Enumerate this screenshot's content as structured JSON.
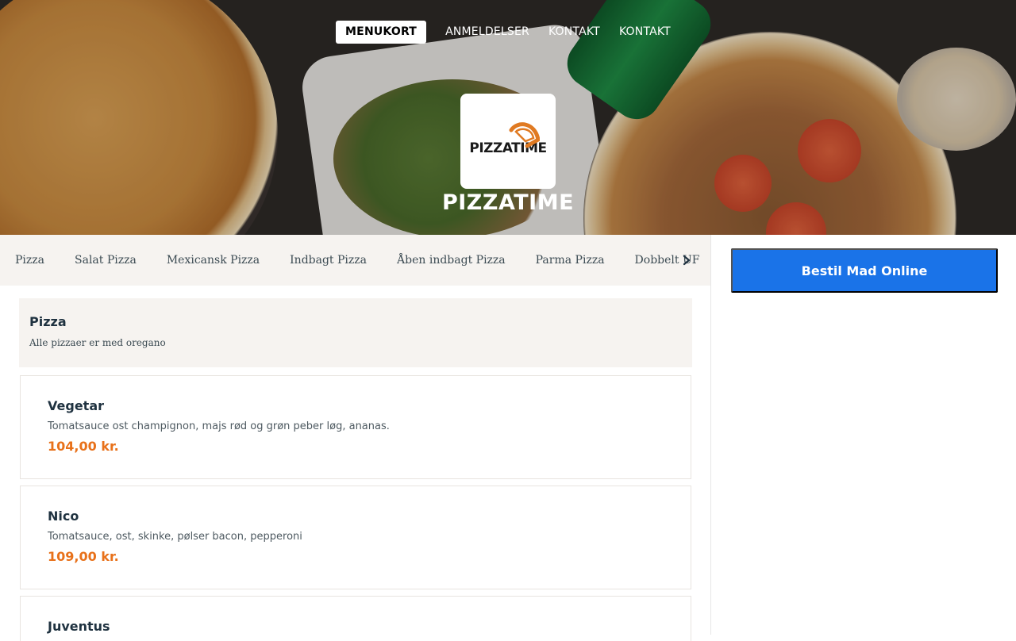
{
  "nav": {
    "items": [
      "MENUKORT",
      "ANMELDELSER",
      "KONTAKT",
      "KONTAKT"
    ]
  },
  "brand": {
    "logo_text": "PIZZATIME",
    "name": "PIZZATIME"
  },
  "categories": [
    "Pizza",
    "Salat Pizza",
    "Mexicansk Pizza",
    "Indbagt Pizza",
    "Åben indbagt Pizza",
    "Parma Pizza",
    "Dobbelt UF"
  ],
  "order_button": "Bestil Mad Online",
  "section": {
    "title": "Pizza",
    "subtitle": "Alle pizzaer er med oregano"
  },
  "items": [
    {
      "name": "Vegetar",
      "desc": "Tomatsauce ost champignon, majs rød og grøn peber løg, ananas.",
      "price": "104,00 kr."
    },
    {
      "name": "Nico",
      "desc": "Tomatsauce, ost, skinke, pølser bacon, pepperoni",
      "price": "109,00 kr."
    },
    {
      "name": "Juventus",
      "desc": "",
      "price": ""
    }
  ],
  "colors": {
    "accent": "#1a73e8",
    "price": "#e8711a",
    "heading": "#1f3240",
    "panel_bg": "#f6f3f0"
  },
  "icons": {
    "category_next": "chevron-right-icon",
    "logo_mark": "pizza-slice-icon"
  }
}
